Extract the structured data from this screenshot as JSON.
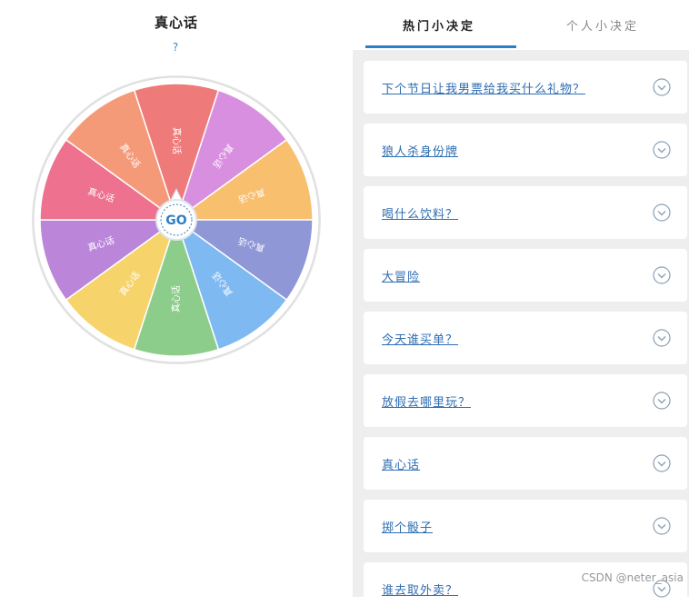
{
  "wheel": {
    "title": "真心话",
    "help_mark": "?",
    "go_label": "GO",
    "segments": [
      {
        "label": "真心话",
        "color": "#ee7b7a"
      },
      {
        "label": "真心话",
        "color": "#d98fe0"
      },
      {
        "label": "真心话",
        "color": "#f7bf6e"
      },
      {
        "label": "真心话",
        "color": "#9097d6"
      },
      {
        "label": "真心话",
        "color": "#7fb9f2"
      },
      {
        "label": "真心话",
        "color": "#8ccd8c"
      },
      {
        "label": "真心话",
        "color": "#f6d46b"
      },
      {
        "label": "真心话",
        "color": "#bb86d9"
      },
      {
        "label": "真心话",
        "color": "#ee7190"
      },
      {
        "label": "真心话",
        "color": "#f59a79"
      }
    ]
  },
  "tabs": {
    "hot": "热门小决定",
    "personal": "个人小决定"
  },
  "decisions": [
    {
      "label": "下个节日让我男票给我买什么礼物？"
    },
    {
      "label": "狼人杀身份牌"
    },
    {
      "label": "喝什么饮料？"
    },
    {
      "label": "大冒险"
    },
    {
      "label": "今天谁买单？"
    },
    {
      "label": "放假去哪里玩？"
    },
    {
      "label": "真心话"
    },
    {
      "label": "掷个骰子"
    },
    {
      "label": "谁去取外卖？"
    }
  ],
  "watermark": "CSDN @neter_asia",
  "colors": {
    "accent": "#2c7fc4",
    "link": "#2f6db1",
    "panel_bg": "#eeeeee"
  }
}
